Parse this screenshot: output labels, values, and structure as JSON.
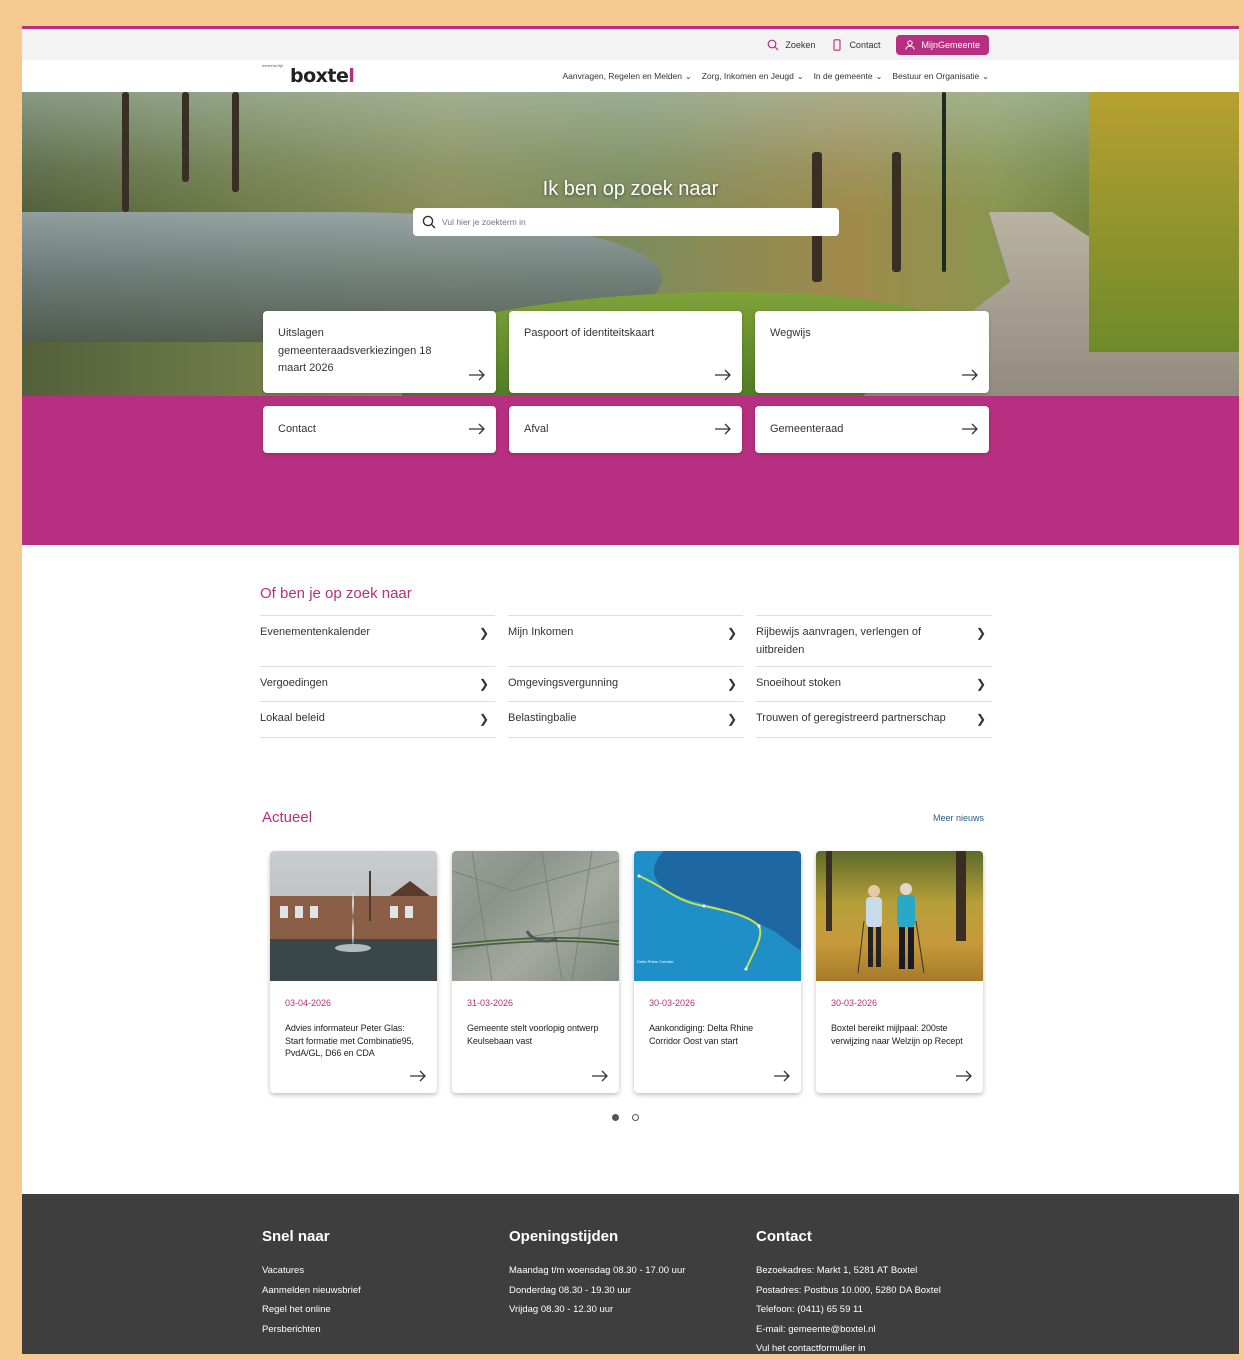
{
  "utility": {
    "search_label": "Zoeken",
    "contact_label": "Contact",
    "mijn_label": "MijnGemeente"
  },
  "logo": {
    "small": "meesterlijk",
    "main_a": "boxte",
    "main_b": "l"
  },
  "nav": [
    "Aanvragen, Regelen en Melden",
    "Zorg, Inkomen en Jeugd",
    "In de gemeente",
    "Bestuur en Organisatie"
  ],
  "hero": {
    "title": "Ik ben op zoek naar",
    "search_placeholder": "Vul hier je zoekterm in"
  },
  "tiles": [
    "Uitslagen gemeenteraadsverkiezingen 18 maart 2026",
    "Paspoort of identiteitskaart",
    "Wegwijs",
    "Contact",
    "Afval",
    "Gemeenteraad"
  ],
  "suggest": {
    "title": "Of ben je op zoek naar",
    "items": [
      "Evenementenkalender",
      "Mijn Inkomen",
      "Rijbewijs aanvragen, verlengen of uitbreiden",
      "Vergoedingen",
      "Omgevingsvergunning",
      "Snoeihout stoken",
      "Lokaal beleid",
      "Belastingbalie",
      "Trouwen of geregistreerd partnerschap"
    ]
  },
  "news": {
    "title": "Actueel",
    "more": "Meer nieuws",
    "items": [
      {
        "date": "03-04-2026",
        "title": "Advies informateur Peter Glas: Start formatie met Combinatie95, PvdA/GL, D66 en CDA",
        "image": "pond-fountain"
      },
      {
        "date": "31-03-2026",
        "title": "Gemeente stelt voorlopig ontwerp Keulsebaan vast",
        "image": "aerial-map"
      },
      {
        "date": "30-03-2026",
        "title": "Aankondiging: Delta Rhine Corridor Oost van start",
        "image": "corridor-map"
      },
      {
        "date": "30-03-2026",
        "title": "Boxtel bereikt mijlpaal: 200ste verwijzing naar Welzijn op Recept",
        "image": "walkers"
      }
    ],
    "map_label": "Delta Rhine Corridor"
  },
  "footer": {
    "snel": {
      "title": "Snel naar",
      "items": [
        "Vacatures",
        "Aanmelden nieuwsbrief",
        "Regel het online",
        "Persberichten"
      ]
    },
    "open": {
      "title": "Openingstijden",
      "items": [
        "Maandag t/m woensdag 08.30 - 17.00 uur",
        "Donderdag 08.30 - 19.30 uur",
        "Vrijdag 08.30 - 12.30 uur"
      ]
    },
    "contact": {
      "title": "Contact",
      "items": [
        "Bezoekadres: Markt 1, 5281 AT Boxtel",
        "Postadres: Postbus 10.000, 5280 DA Boxtel",
        "Telefoon: (0411) 65 59 11",
        "E-mail: gemeente@boxtel.nl",
        "Vul het contactformulier in"
      ]
    }
  },
  "colors": {
    "brand": "#b62f80",
    "footer": "#3e3e3e",
    "frame": "#f5c98f"
  }
}
